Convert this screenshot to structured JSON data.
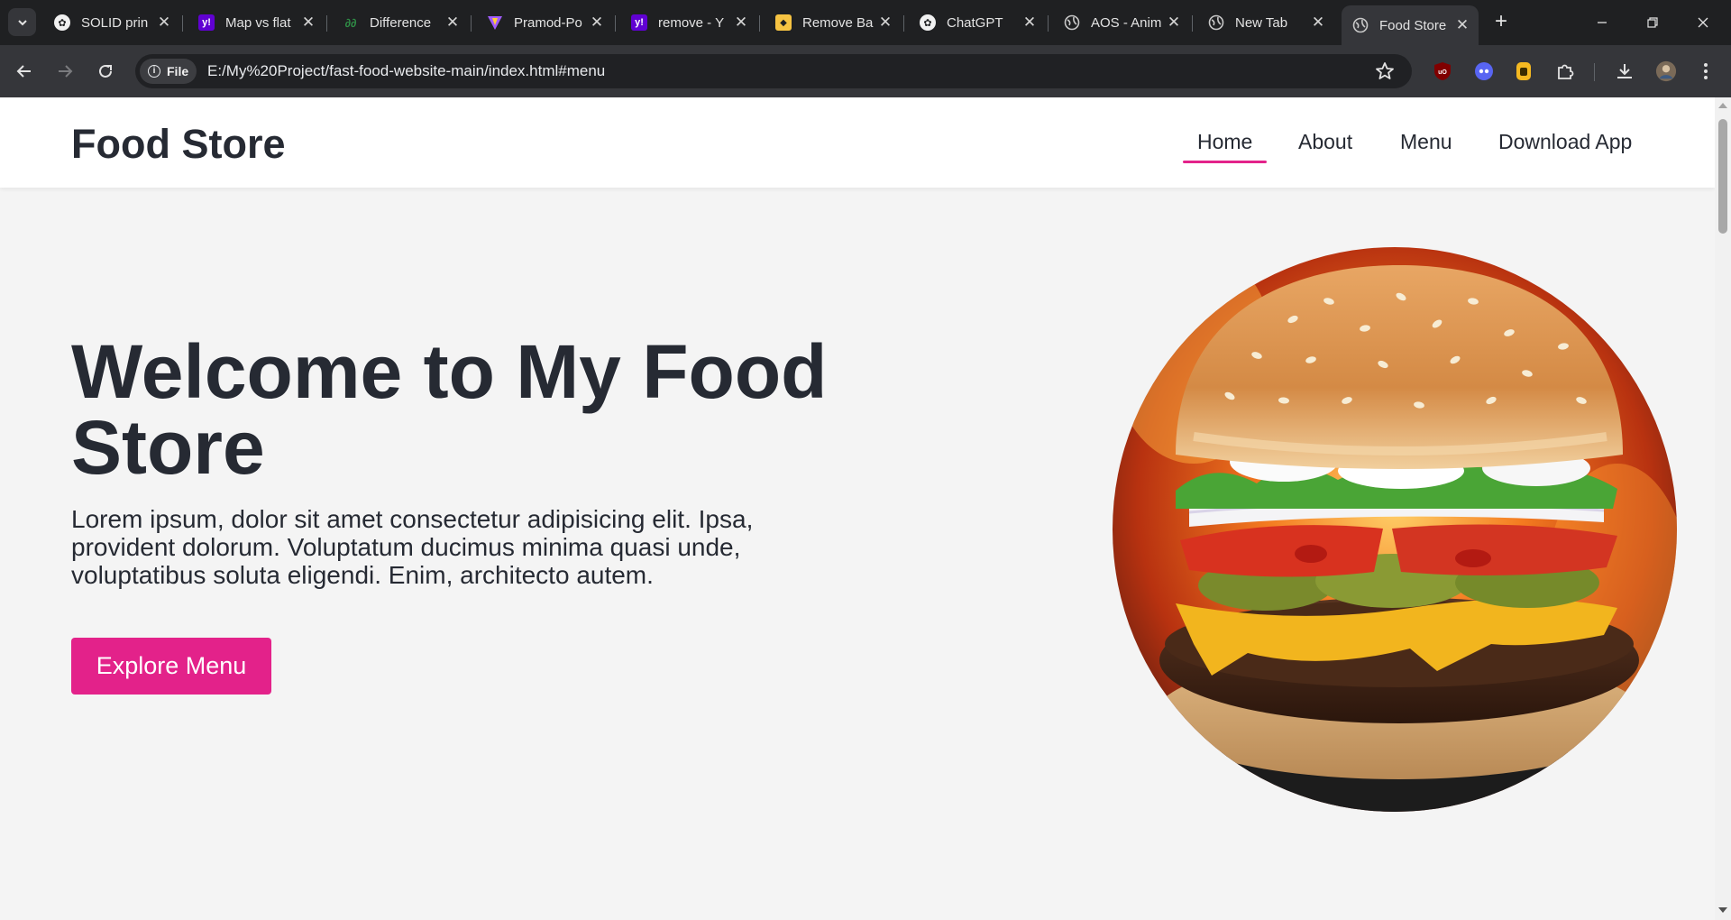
{
  "browser": {
    "tabs": [
      {
        "title": "SOLID prin",
        "icon": "chatgpt-icon",
        "active": false
      },
      {
        "title": "Map vs flat",
        "icon": "yahoo-icon",
        "active": false
      },
      {
        "title": "Difference",
        "icon": "geeksforgeeks-icon",
        "active": false
      },
      {
        "title": "Pramod-Po",
        "icon": "vite-icon",
        "active": false
      },
      {
        "title": "remove - Y",
        "icon": "yahoo-icon",
        "active": false
      },
      {
        "title": "Remove Ba",
        "icon": "removebg-icon",
        "active": false
      },
      {
        "title": "ChatGPT",
        "icon": "chatgpt-icon",
        "active": false
      },
      {
        "title": "AOS - Anim",
        "icon": "globe-icon",
        "active": false
      },
      {
        "title": "New Tab",
        "icon": "globe-icon",
        "active": false
      },
      {
        "title": "Food Store",
        "icon": "globe-icon",
        "active": true
      }
    ],
    "address": {
      "scheme_chip": "File",
      "url": "E:/My%20Project/fast-food-website-main/index.html#menu"
    }
  },
  "site": {
    "logo": "Food Store",
    "nav": {
      "home": "Home",
      "about": "About",
      "menu": "Menu",
      "download": "Download App"
    },
    "hero": {
      "title": "Welcome to My Food Store",
      "text": "Lorem ipsum, dolor sit amet consectetur adipisicing elit. Ipsa, provident dolorum. Voluptatum ducimus minima quasi unde, voluptatibus soluta eligendi. Enim, architecto autem.",
      "cta": "Explore Menu",
      "image": "burger-image"
    }
  },
  "colors": {
    "accent": "#e3228a",
    "text": "#262a33",
    "page_bg": "#f4f4f4",
    "header_bg": "#ffffff",
    "chrome_bg": "#1f2022",
    "toolbar_bg": "#35363a"
  }
}
